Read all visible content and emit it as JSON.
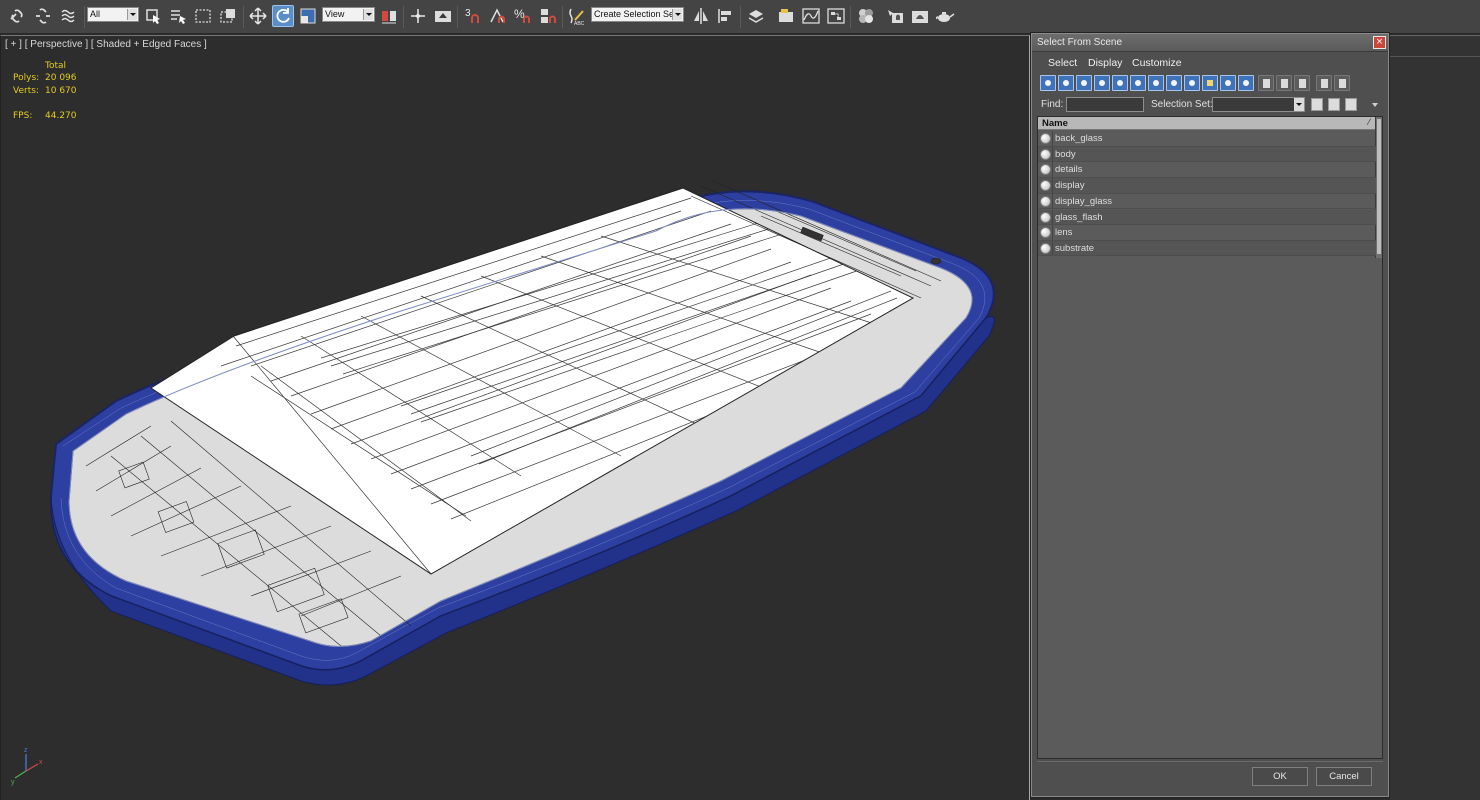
{
  "toolbar": {
    "filter_select": "All",
    "refcoord_select": "View",
    "selection_set_select": "Create Selection Se",
    "snap_labels": {
      "snap3": "3",
      "angle_percent": "%",
      "abc": "ABC"
    }
  },
  "viewport": {
    "label": "[ + ] [ Perspective ] [ Shaded + Edged Faces ]",
    "stats": {
      "total_label": "Total",
      "polys_label": "Polys:",
      "polys_value": "20 096",
      "verts_label": "Verts:",
      "verts_value": "10 670",
      "fps_label": "FPS:",
      "fps_value": "44.270"
    },
    "axis": {
      "x": "x",
      "y": "y",
      "z": "z"
    }
  },
  "dialog": {
    "title": "Select From Scene",
    "close_label": "×",
    "menu": [
      "Select",
      "Display",
      "Customize"
    ],
    "find_label": "Find:",
    "find_value": "",
    "selection_set_label": "Selection Set:",
    "list_header": "Name",
    "sort_indicator": "⁄",
    "items": [
      "back_glass",
      "body",
      "details",
      "display",
      "display_glass",
      "glass_flash",
      "lens",
      "substrate"
    ],
    "ok_label": "OK",
    "cancel_label": "Cancel"
  },
  "colors": {
    "phone_blue": "#2d3fa0",
    "screen_white": "#ffffff",
    "stats_yellow": "#e3cc1e",
    "active_tool": "#5b8ec8"
  }
}
